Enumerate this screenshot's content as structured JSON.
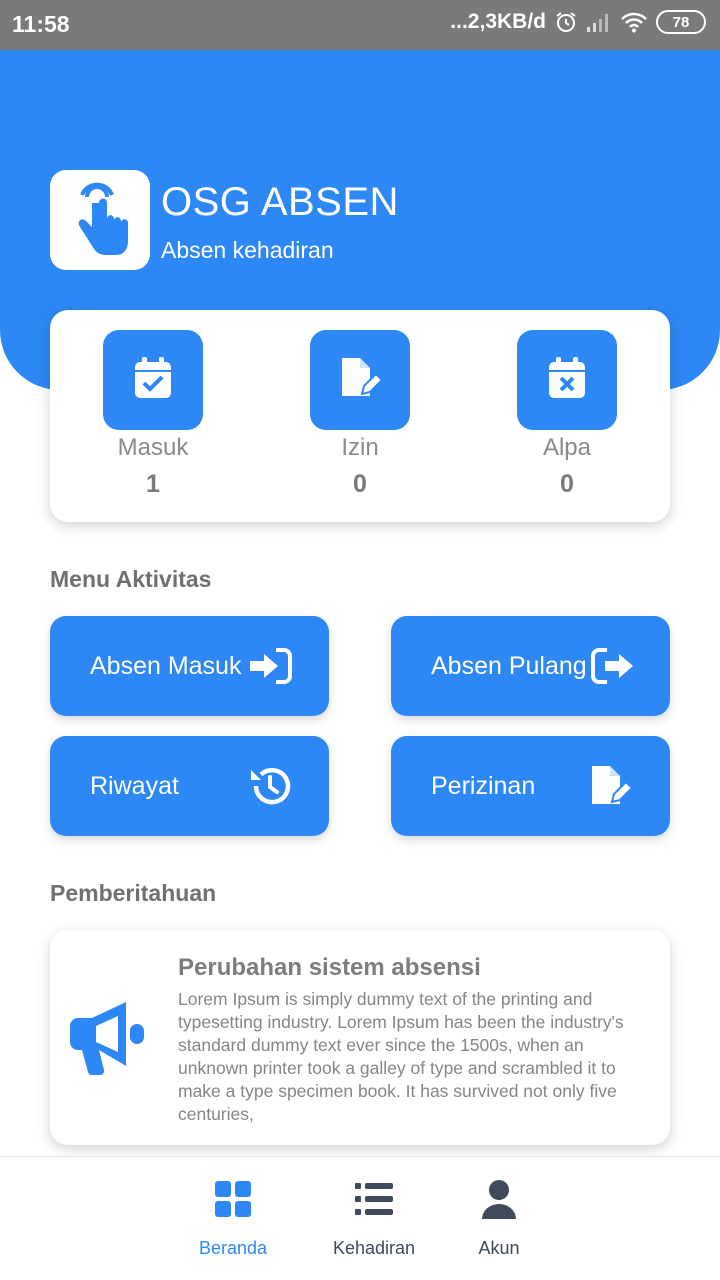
{
  "status_bar": {
    "time": "11:58",
    "network_speed": "...2,3KB/d",
    "battery": "78",
    "icons": [
      "alarm-icon",
      "signal-icon",
      "wifi-icon",
      "battery-icon"
    ]
  },
  "header": {
    "title": "OSG ABSEN",
    "subtitle": "Absen kehadiran",
    "logo_icon": "tap-hand-icon"
  },
  "stats": [
    {
      "label": "Masuk",
      "value": "1",
      "icon": "calendar-check-icon"
    },
    {
      "label": "Izin",
      "value": "0",
      "icon": "file-edit-icon"
    },
    {
      "label": "Alpa",
      "value": "0",
      "icon": "calendar-x-icon"
    }
  ],
  "menu": {
    "title": "Menu Aktivitas",
    "items": [
      {
        "label": "Absen Masuk",
        "icon": "sign-in-icon"
      },
      {
        "label": "Absen Pulang",
        "icon": "sign-out-icon"
      },
      {
        "label": "Riwayat",
        "icon": "history-icon"
      },
      {
        "label": "Perizinan",
        "icon": "file-edit-icon"
      }
    ]
  },
  "notifications": {
    "title": "Pemberitahuan",
    "items": [
      {
        "title": "Perubahan sistem absensi",
        "body": "Lorem Ipsum is simply dummy text of the printing and typesetting industry. Lorem Ipsum has been the industry's standard dummy text ever since the 1500s, when an unknown printer took a galley of type and scrambled it to make a type specimen book. It has survived not only five centuries,",
        "icon": "megaphone-icon"
      }
    ]
  },
  "bottom_nav": [
    {
      "label": "Beranda",
      "icon": "grid-icon",
      "active": true
    },
    {
      "label": "Kehadiran",
      "icon": "list-icon",
      "active": false
    },
    {
      "label": "Akun",
      "icon": "user-icon",
      "active": false
    }
  ],
  "colors": {
    "primary": "#2d88f5",
    "status_bar": "#7a7a7a",
    "text_muted": "#8a8a8a",
    "nav_inactive": "#3f4a5a"
  }
}
